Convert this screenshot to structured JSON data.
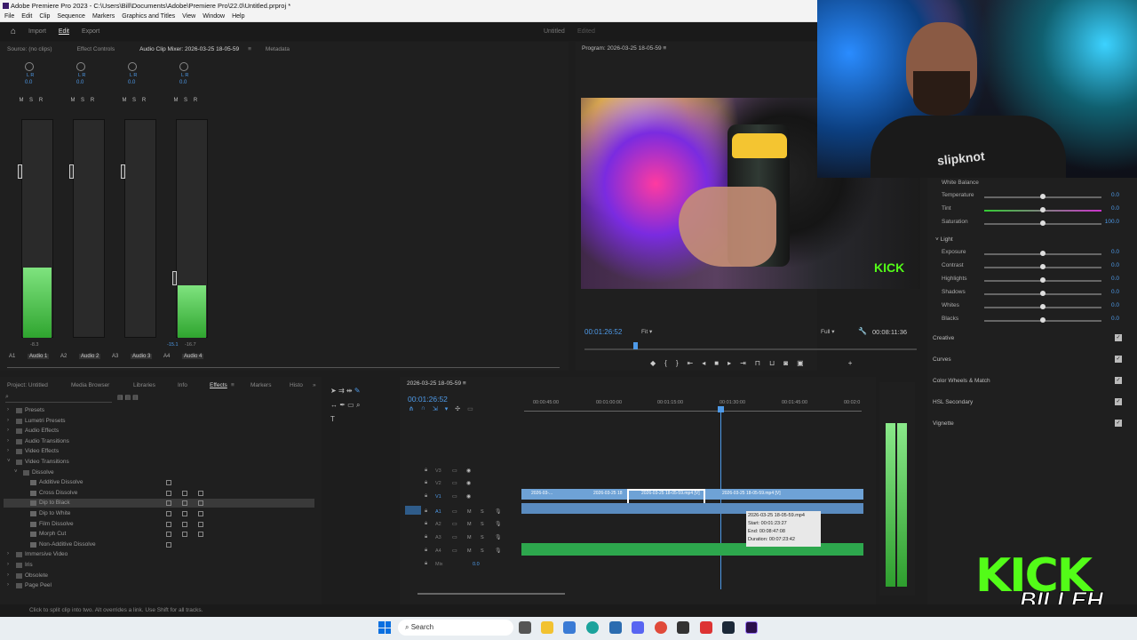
{
  "window": {
    "title": "Adobe Premiere Pro 2023 - C:\\Users\\Bill\\Documents\\Adobe\\Premiere Pro\\22.0\\Untitled.prproj *"
  },
  "menu": [
    "File",
    "Edit",
    "Clip",
    "Sequence",
    "Markers",
    "Graphics and Titles",
    "View",
    "Window",
    "Help"
  ],
  "workspaces": {
    "import": "Import",
    "edit": "Edit",
    "export": "Export",
    "project": "Untitled",
    "status": "Edited"
  },
  "source_tabs": [
    "Source: (no clips)",
    "Effect Controls",
    "Audio Clip Mixer: 2026-03-25 18-05-59",
    "Metadata"
  ],
  "mixer": {
    "channels": [
      {
        "id": "A1",
        "name": "Audio 1",
        "value": "-8.3",
        "level": 0.32
      },
      {
        "id": "A2",
        "name": "Audio 2",
        "value": "",
        "level": 0.0
      },
      {
        "id": "A3",
        "name": "Audio 3",
        "value": "",
        "level": 0.0
      },
      {
        "id": "A4",
        "name": "Audio 4",
        "value": "-16.7",
        "level": 0.24
      }
    ],
    "pan": "0.0",
    "msr": [
      "M",
      "S",
      "R"
    ],
    "lr": "L R",
    "master": "-15.1"
  },
  "program": {
    "tab": "Program: 2026-03-25 18-05-59",
    "timecode": "00:01:26:52",
    "fit": "Fit",
    "quality": "Full",
    "duration": "00:08:11:36"
  },
  "lumetri": {
    "white_balance": "White Balance",
    "wb_rows": [
      {
        "label": "Temperature",
        "value": "0.0",
        "pos": 0.5
      },
      {
        "label": "Tint",
        "value": "0.0",
        "pos": 0.5
      },
      {
        "label": "Saturation",
        "value": "100.0",
        "pos": 0.5
      }
    ],
    "light": "Light",
    "light_rows": [
      {
        "label": "Exposure",
        "value": "0.0",
        "pos": 0.5
      },
      {
        "label": "Contrast",
        "value": "0.0",
        "pos": 0.5
      },
      {
        "label": "Highlights",
        "value": "0.0",
        "pos": 0.5
      },
      {
        "label": "Shadows",
        "value": "0.0",
        "pos": 0.5
      },
      {
        "label": "Whites",
        "value": "0.0",
        "pos": 0.5
      },
      {
        "label": "Blacks",
        "value": "0.0",
        "pos": 0.5
      }
    ],
    "sections": [
      "Creative",
      "Curves",
      "Color Wheels & Match",
      "HSL Secondary",
      "Vignette"
    ]
  },
  "project_tabs": [
    "Project: Untitled",
    "Media Browser",
    "Libraries",
    "Info",
    "Effects",
    "Markers",
    "Histo"
  ],
  "effects_tree": [
    "Presets",
    "Lumetri Presets",
    "Audio Effects",
    "Audio Transitions",
    "Video Effects",
    "Video Transitions",
    "Dissolve",
    "Additive Dissolve",
    "Cross Dissolve",
    "Dip to Black",
    "Dip to White",
    "Film Dissolve",
    "Morph Cut",
    "Non-Additive Dissolve",
    "Immersive Video",
    "Iris",
    "Obsolete",
    "Page Peel"
  ],
  "timeline": {
    "tab": "2026-03-25 18-05-59",
    "timecode": "00:01:26:52",
    "ruler": [
      "00:00:45:00",
      "00:01:00:00",
      "00:01:15:00",
      "00:01:30:00",
      "00:01:45:00",
      "00:02:0"
    ],
    "tracks": [
      "V3",
      "V2",
      "V1",
      "A1",
      "A2",
      "A3",
      "A4",
      "Mix"
    ],
    "mix_val": "0.0",
    "clips": [
      "2026-03-...",
      "2026-03-25 18",
      "2026-03-25 18-05-59.mp4 [V]",
      "2026-03-25 18-05-59.mp4 [V]"
    ],
    "tooltip": {
      "name": "2026-03-25 18-05-59.mp4",
      "start": "Start: 00:01:23:27",
      "end": "End: 00:08:47:08",
      "duration": "Duration: 00:07:23:42"
    }
  },
  "status": "Click to split clip into two. Alt overrides a link. Use Shift for all tracks.",
  "taskbar": {
    "search": "Search"
  },
  "overlay": {
    "kick": "KICK",
    "billeh": "BILLEH",
    "shirt": "slipknot"
  },
  "colors": {
    "accent": "#4e9ae8",
    "clip_video": "#6ea2d6",
    "clip_audio": "#2da74d",
    "meter": "#4fd04f"
  }
}
